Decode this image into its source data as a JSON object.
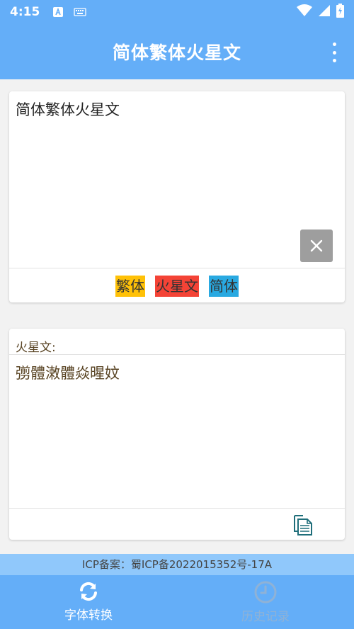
{
  "status_bar": {
    "time": "4:15",
    "icons": [
      "font-notification-icon",
      "keyboard-icon",
      "wifi-icon",
      "signal-icon",
      "battery-charging-icon"
    ]
  },
  "app_bar": {
    "title": "简体繁体火星文",
    "menu_icon": "more-vert-icon"
  },
  "input_card": {
    "text": "简体繁体火星文",
    "clear_icon": "close-icon",
    "buttons": {
      "traditional": "繁体",
      "martian": "火星文",
      "simplified": "简体"
    }
  },
  "output_card": {
    "label": "火星文:",
    "text": "彅體潄體焱暒妏",
    "copy_icon": "copy-icon"
  },
  "footer": {
    "icp": "ICP备案：蜀ICP备2022015352号-17A"
  },
  "tabs": [
    {
      "label": "字体转换",
      "icon": "sync-icon",
      "active": true
    },
    {
      "label": "历史记录",
      "icon": "clock-icon",
      "active": false
    }
  ],
  "colors": {
    "primary": "#64aef8",
    "traditional_button": "#ffc107",
    "martian_button": "#f44336",
    "simplified_button": "#29a9e1",
    "output_text": "#5a4525",
    "clear_button": "#9e9e9e"
  }
}
